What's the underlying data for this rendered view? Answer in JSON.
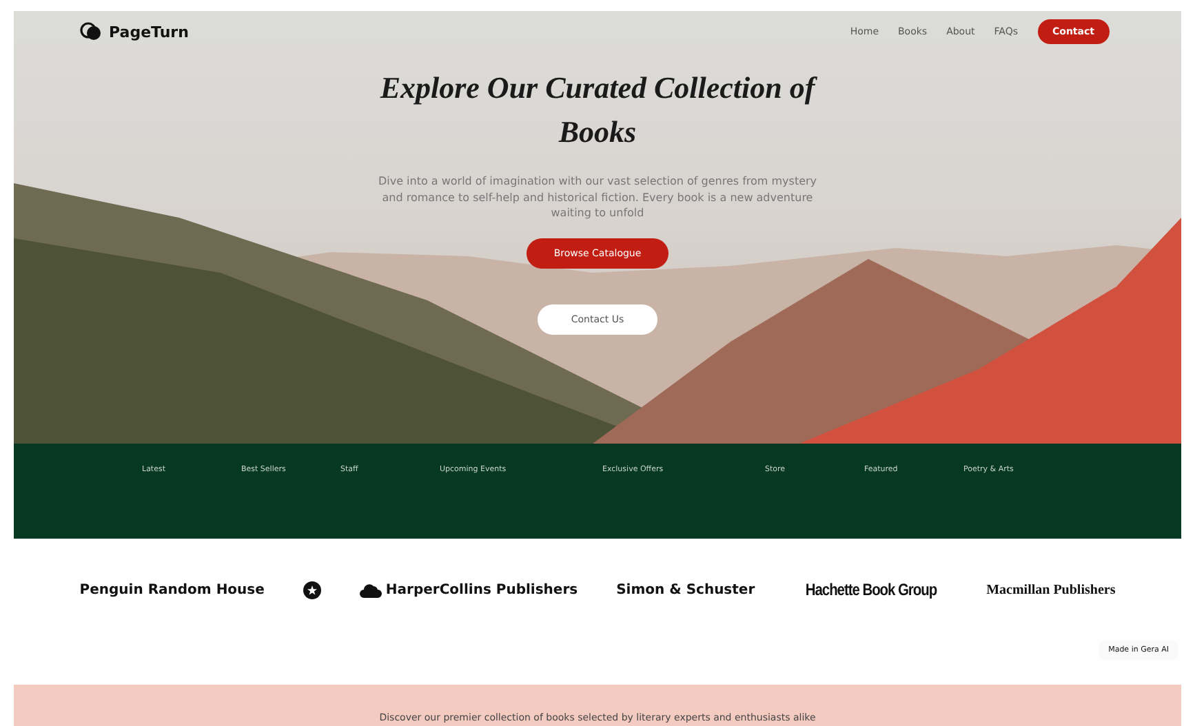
{
  "brand": {
    "name": "PageTurn"
  },
  "nav": {
    "links": [
      "Home",
      "Books",
      "About",
      "FAQs"
    ],
    "cta": "Contact"
  },
  "hero": {
    "title": "Explore Our Curated Collection of Books",
    "description": "Dive into a world of imagination with our vast selection of genres from mystery and romance to self-help and historical fiction. Every book is a new adventure waiting to unfold",
    "primary_button": "Browse Catalogue",
    "secondary_button": "Contact Us"
  },
  "categories": [
    "Latest",
    "Best Sellers",
    "Staff",
    "Upcoming Events",
    "Exclusive Offers",
    "Store",
    "Featured",
    "Poetry & Arts"
  ],
  "publishers": [
    {
      "kind": "text",
      "name": "Penguin Random House"
    },
    {
      "kind": "badge"
    },
    {
      "kind": "cloud",
      "name": "HarperCollins Publishers"
    },
    {
      "kind": "text",
      "name": "Simon & Schuster"
    },
    {
      "kind": "condensed",
      "name": "Hachette Book Group"
    },
    {
      "kind": "serif",
      "name": "Macmillan Publishers"
    }
  ],
  "made_in_badge": "Made in Gera AI",
  "intro": {
    "text": "Discover our premier collection of books selected by literary experts and enthusiasts alike"
  }
}
